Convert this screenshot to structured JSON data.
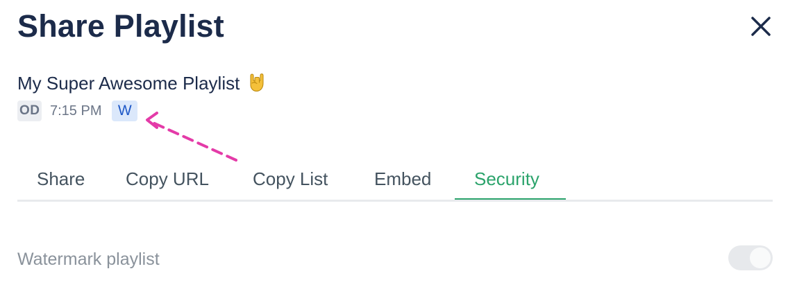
{
  "dialog": {
    "title": "Share Playlist",
    "close_icon": "close-icon"
  },
  "playlist": {
    "name": "My Super Awesome Playlist",
    "emoji": "rock-on-hand-emoji",
    "owner_initials": "OD",
    "time": "7:15 PM",
    "badge": "W"
  },
  "tabs": [
    {
      "label": "Share",
      "active": false
    },
    {
      "label": "Copy URL",
      "active": false
    },
    {
      "label": "Copy List",
      "active": false
    },
    {
      "label": "Embed",
      "active": false
    },
    {
      "label": "Security",
      "active": true
    }
  ],
  "security": {
    "watermark_label": "Watermark playlist",
    "watermark_enabled": true
  },
  "colors": {
    "title": "#1c2b4a",
    "accent": "#2ba36b",
    "annotation_arrow": "#e43ba8",
    "badge_w_bg": "#dbe8fb",
    "badge_w_text": "#1e58c7"
  }
}
